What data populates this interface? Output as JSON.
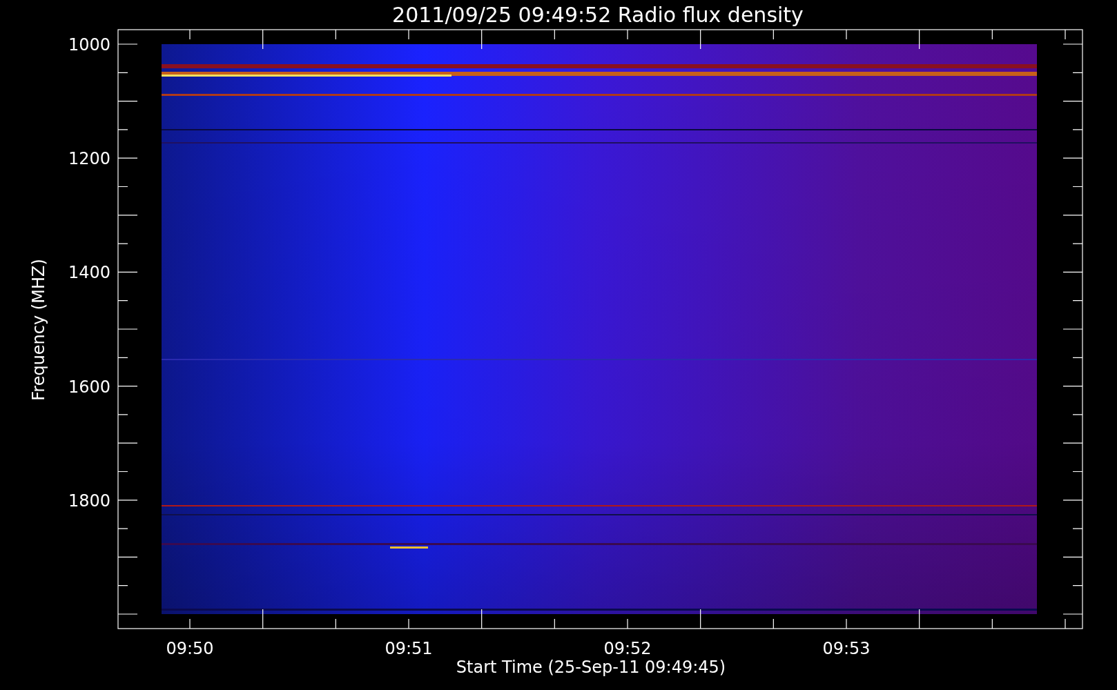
{
  "title": "2011/09/25 09:49:52 Radio flux density",
  "y_axis": {
    "label": "Frequency (MHZ)",
    "ticks": [
      "1000",
      "1200",
      "1400",
      "1600",
      "1800"
    ]
  },
  "x_axis": {
    "label": "Start Time (25-Sep-11 09:49:45)",
    "ticks": [
      "09:50",
      "09:51",
      "09:52",
      "09:53"
    ]
  }
}
